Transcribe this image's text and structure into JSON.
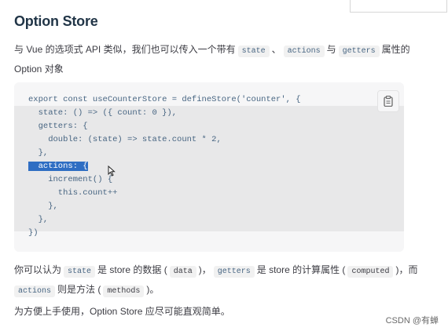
{
  "heading": "Option Store",
  "intro": {
    "t1": "与 Vue 的选项式 API 类似，我们也可以传入一个带有",
    "state": "state",
    "sep1": "、",
    "actions": "actions",
    "t2": "与",
    "getters": "getters",
    "t3": "属性的",
    "t4": "Option 对象"
  },
  "code": {
    "lines": [
      "export const useCounterStore = defineStore('counter', {",
      "  state: () => ({ count: 0 }),",
      "  getters: {",
      "    double: (state) => state.count * 2,",
      "  },",
      "  actions: {",
      "    increment() {",
      "      this.count++",
      "    },",
      "  },",
      "})"
    ],
    "copy_icon": "clipboard-icon"
  },
  "para2": {
    "t1": "你可以认为",
    "state": "state",
    "t2": "是 store 的数据 (",
    "data": "data",
    "t3": ")，",
    "getters": "getters",
    "t4": "是 store 的计算属性 (",
    "computed": "computed",
    "t5": ")，而",
    "actions": "actions",
    "t6": "则是方法 (",
    "methods": "methods",
    "t7": ")。"
  },
  "para3": "为方便上手使用，Option Store 应尽可能直观简单。",
  "watermark": "CSDN @有蝉"
}
